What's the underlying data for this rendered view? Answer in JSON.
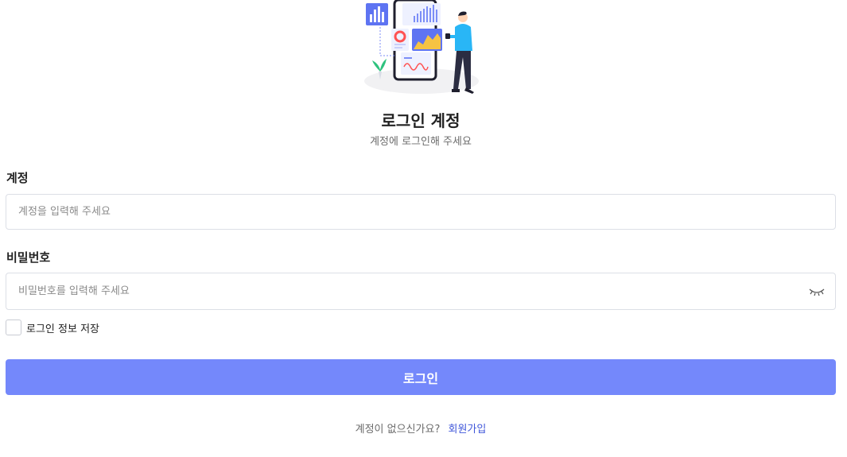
{
  "header": {
    "title": "로그인 계정",
    "subtitle": "계정에 로그인해 주세요"
  },
  "form": {
    "account": {
      "label": "계정",
      "placeholder": "계정을 입력해 주세요",
      "value": ""
    },
    "password": {
      "label": "비밀번호",
      "placeholder": "비밀번호를 입력해 주세요",
      "value": "",
      "toggle_icon": "eye-closed-icon"
    },
    "remember": {
      "label": "로그인 정보 저장",
      "checked": false
    },
    "submit_label": "로그인"
  },
  "footer": {
    "prompt": "계정이 없으신가요?",
    "signup_link": "회원가입"
  },
  "colors": {
    "accent": "#7488fb",
    "link": "#3f56d9",
    "illustration_primary": "#4d6cf5",
    "illustration_person": "#29b6f6"
  }
}
